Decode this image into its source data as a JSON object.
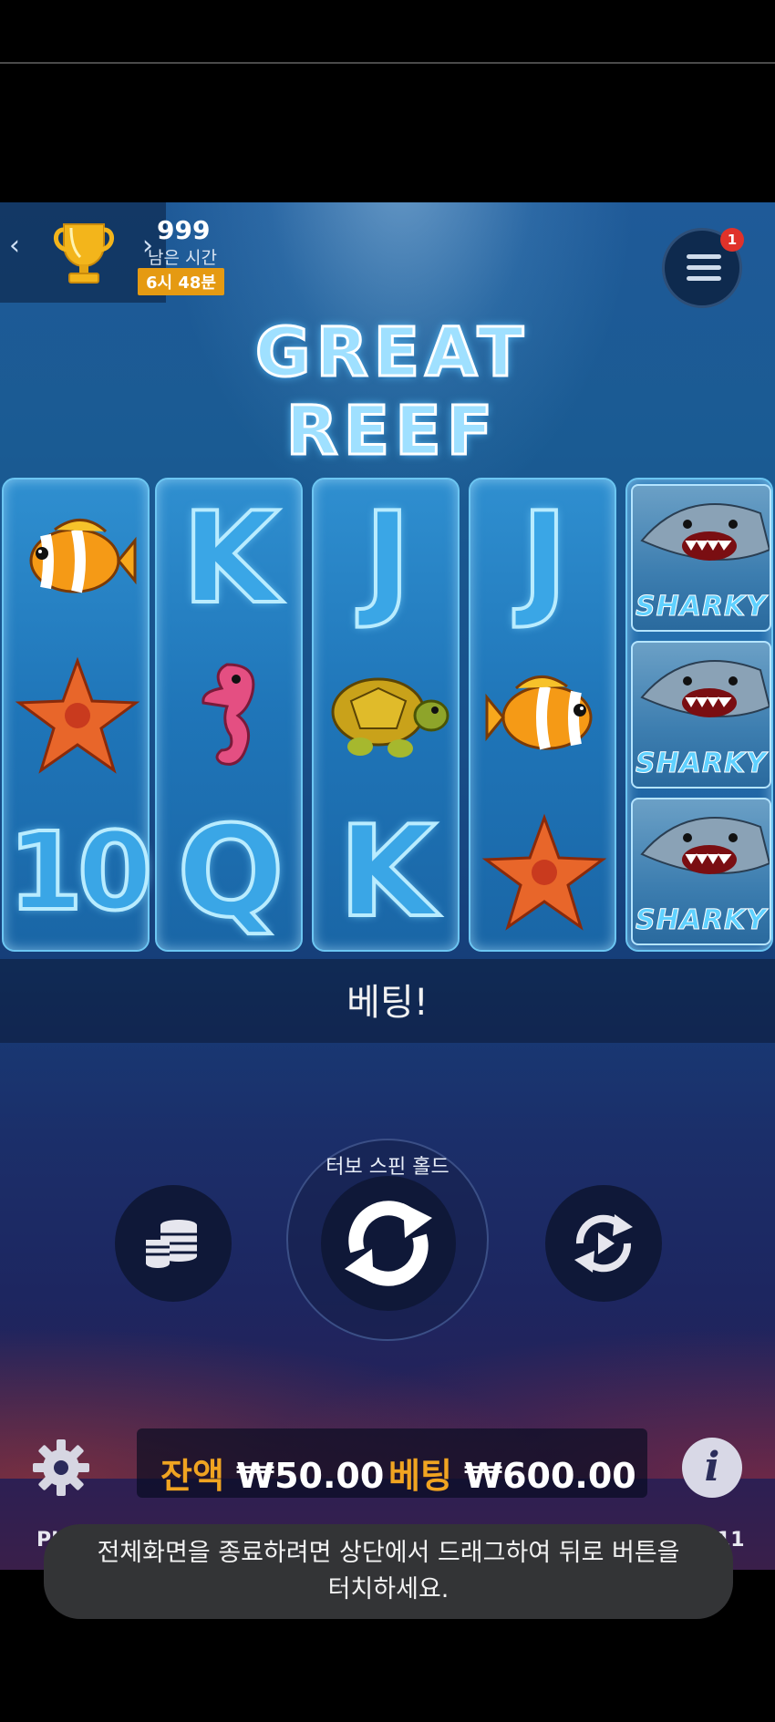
{
  "leaderboard": {
    "count": "999",
    "remaining_label": "남은 시간",
    "time_left": "6시 48분"
  },
  "menu": {
    "notification_count": "1"
  },
  "game_title": "GREAT REEF",
  "reels": [
    [
      "clownfish",
      "starfish",
      "10"
    ],
    [
      "K",
      "seahorse",
      "Q"
    ],
    [
      "J",
      "turtle",
      "K"
    ],
    [
      "J",
      "clownfish",
      "starfish"
    ],
    [
      "sharky",
      "sharky",
      "sharky"
    ]
  ],
  "shark_label": "SHARKY",
  "status_message": "베팅!",
  "spin": {
    "turbo_label": "터보 스핀 홀드"
  },
  "balance": {
    "label": "잔액",
    "value": "₩50.00"
  },
  "bet": {
    "label": "베팅",
    "value": "₩600.00"
  },
  "footer": {
    "left_text": "PI",
    "right_text": "11"
  },
  "toast": {
    "line1": "전체화면을 종료하려면 상단에서 드래그하여 뒤로 버튼을",
    "line2": "터치하세요."
  },
  "colors": {
    "accent_orange": "#f0a421",
    "badge_red": "#e0322a",
    "reel_blue": "#2f8fd0"
  }
}
